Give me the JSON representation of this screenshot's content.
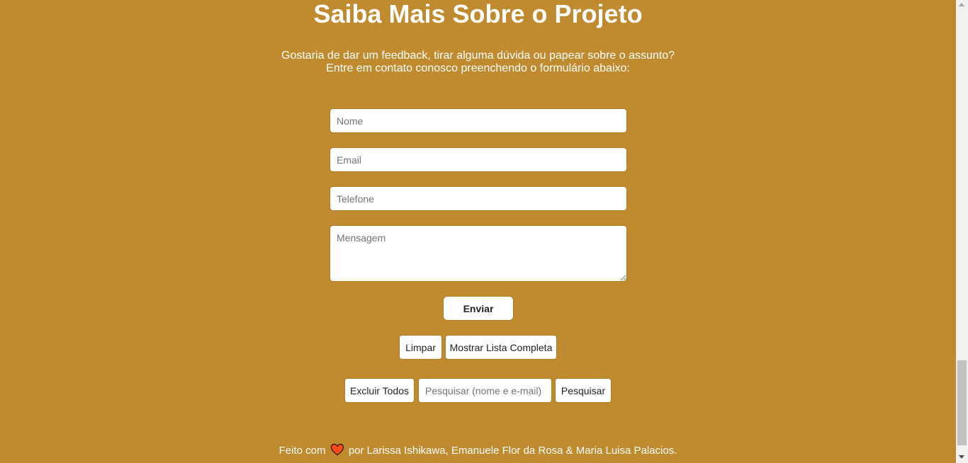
{
  "section": {
    "title": "Saiba Mais Sobre o Projeto",
    "subtitle_line1": "Gostaria de dar um feedback, tirar alguma dúvida ou papear sobre o assunto?",
    "subtitle_line2": "Entre em contato conosco preenchendo o formulário abaixo:"
  },
  "form": {
    "name_placeholder": "Nome",
    "email_placeholder": "Email",
    "phone_placeholder": "Telefone",
    "message_placeholder": "Mensagem",
    "send_label": "Enviar"
  },
  "actions": {
    "clear_label": "Limpar",
    "show_list_label": "Mostrar Lista Completa",
    "delete_all_label": "Excluir Todos",
    "search_placeholder": "Pesquisar (nome e e-mail)",
    "search_label": "Pesquisar"
  },
  "footer": {
    "prefix": "Feito com",
    "suffix": "por Larissa Ishikawa, Emanuele Flor da Rosa & Maria Luisa Palacios."
  },
  "colors": {
    "background": "#c08b2e",
    "heart_fill": "#ff4d1a",
    "heart_stroke": "#3a1a00"
  },
  "icons": {
    "heart": "heart-icon"
  }
}
